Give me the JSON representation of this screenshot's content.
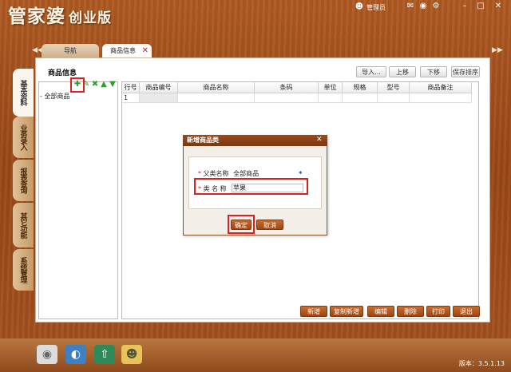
{
  "app": {
    "title": "管家婆",
    "edition": "创业版",
    "version": "版本：3.5.1.13"
  },
  "topbar": {
    "user": "管理员"
  },
  "tabs": [
    {
      "label": "导航"
    },
    {
      "label": "商品信息"
    }
  ],
  "sidebar": [
    {
      "label": "基本资料"
    },
    {
      "label": "业务录入"
    },
    {
      "label": "报表查询"
    },
    {
      "label": "其它功能"
    },
    {
      "label": "系统管理"
    }
  ],
  "panel": {
    "title": "商品信息",
    "toolbar": {
      "import": "导入...",
      "move_up": "上移",
      "move_down": "下移",
      "save_order": "保存排序"
    }
  },
  "tree": {
    "root": "全部商品"
  },
  "grid": {
    "columns": [
      "行号",
      "商品编号",
      "商品名称",
      "条码",
      "单位",
      "规格",
      "型号",
      "商品备注"
    ],
    "rows": [
      {
        "row_no": "1"
      }
    ]
  },
  "actions": {
    "add": "新增",
    "copy_add": "复制新增",
    "edit": "编辑",
    "delete": "删除",
    "print": "打印",
    "exit": "退出"
  },
  "dialog": {
    "title": "新增商品类",
    "parent_label": "父类名称",
    "parent_value": "全部商品",
    "name_label": "类 名 称",
    "name_value": "苹果",
    "ok": "确定",
    "cancel": "取消"
  }
}
